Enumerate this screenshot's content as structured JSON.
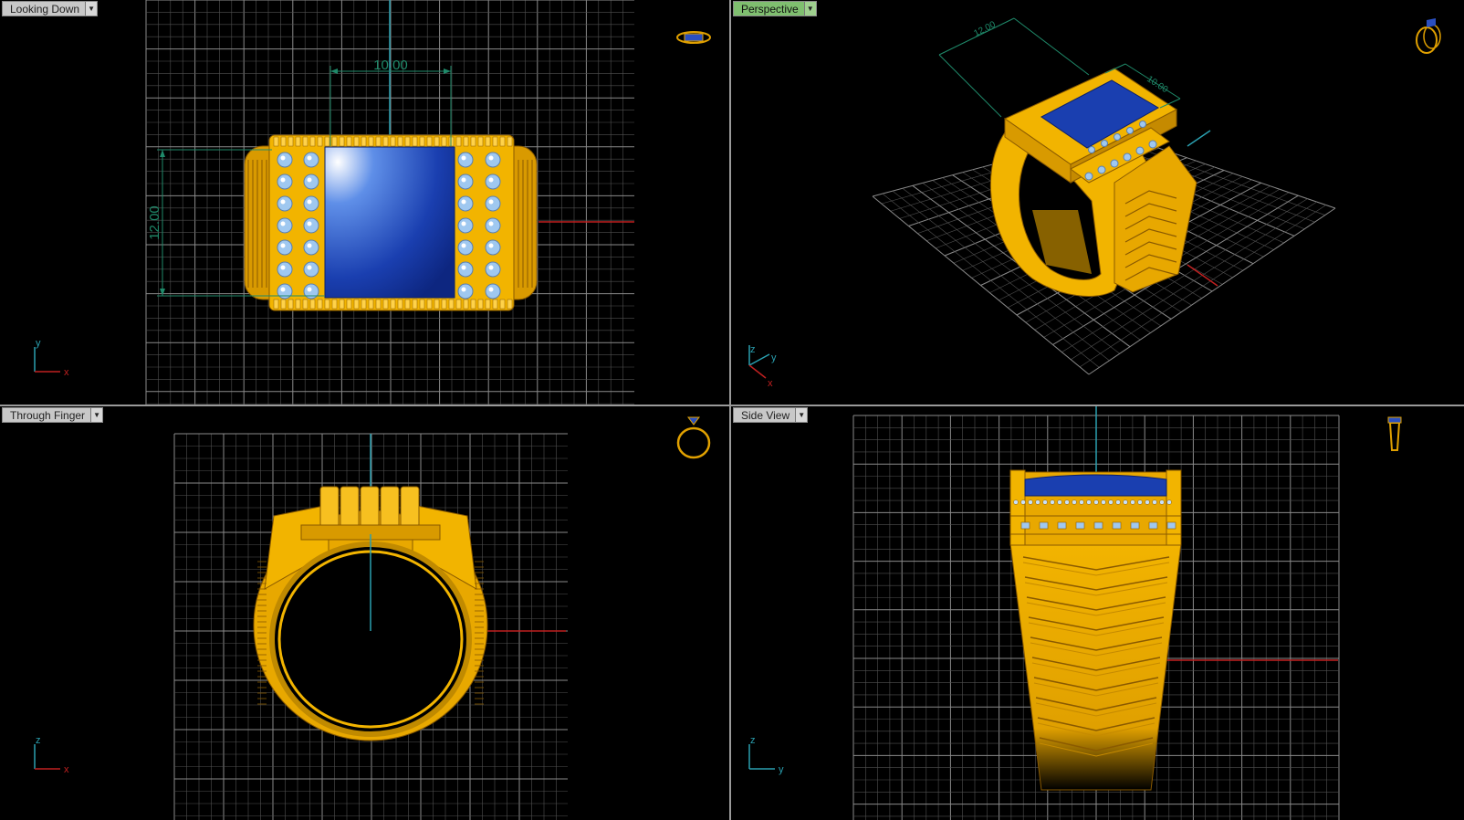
{
  "viewports": [
    {
      "label": "Looking Down",
      "active": false
    },
    {
      "label": "Perspective",
      "active": true
    },
    {
      "label": "Through Finger",
      "active": false
    },
    {
      "label": "Side View",
      "active": false
    }
  ],
  "dimensions": {
    "top_width": "10.00",
    "top_height": "12.00",
    "persp_a": "12.00",
    "persp_b": "10.00"
  },
  "axes": {
    "top": {
      "v": "y",
      "h": "x"
    },
    "persp": {
      "v": "z",
      "y": "y",
      "x": "x"
    },
    "front": {
      "v": "z",
      "h": "x"
    },
    "side": {
      "v": "z",
      "h": "y"
    }
  },
  "colors": {
    "gold": "#f2b400",
    "gold_dark": "#b07800",
    "stone": "#1a3fb0",
    "grid": "#6a6a6a",
    "dim": "#1f8a6a",
    "axis_red": "#c02020",
    "axis_green": "#2aa0b0"
  },
  "icons": [
    "ring-top-icon",
    "ring-perspective-icon",
    "ring-front-icon",
    "ring-side-icon",
    "dropdown-arrow-icon"
  ]
}
